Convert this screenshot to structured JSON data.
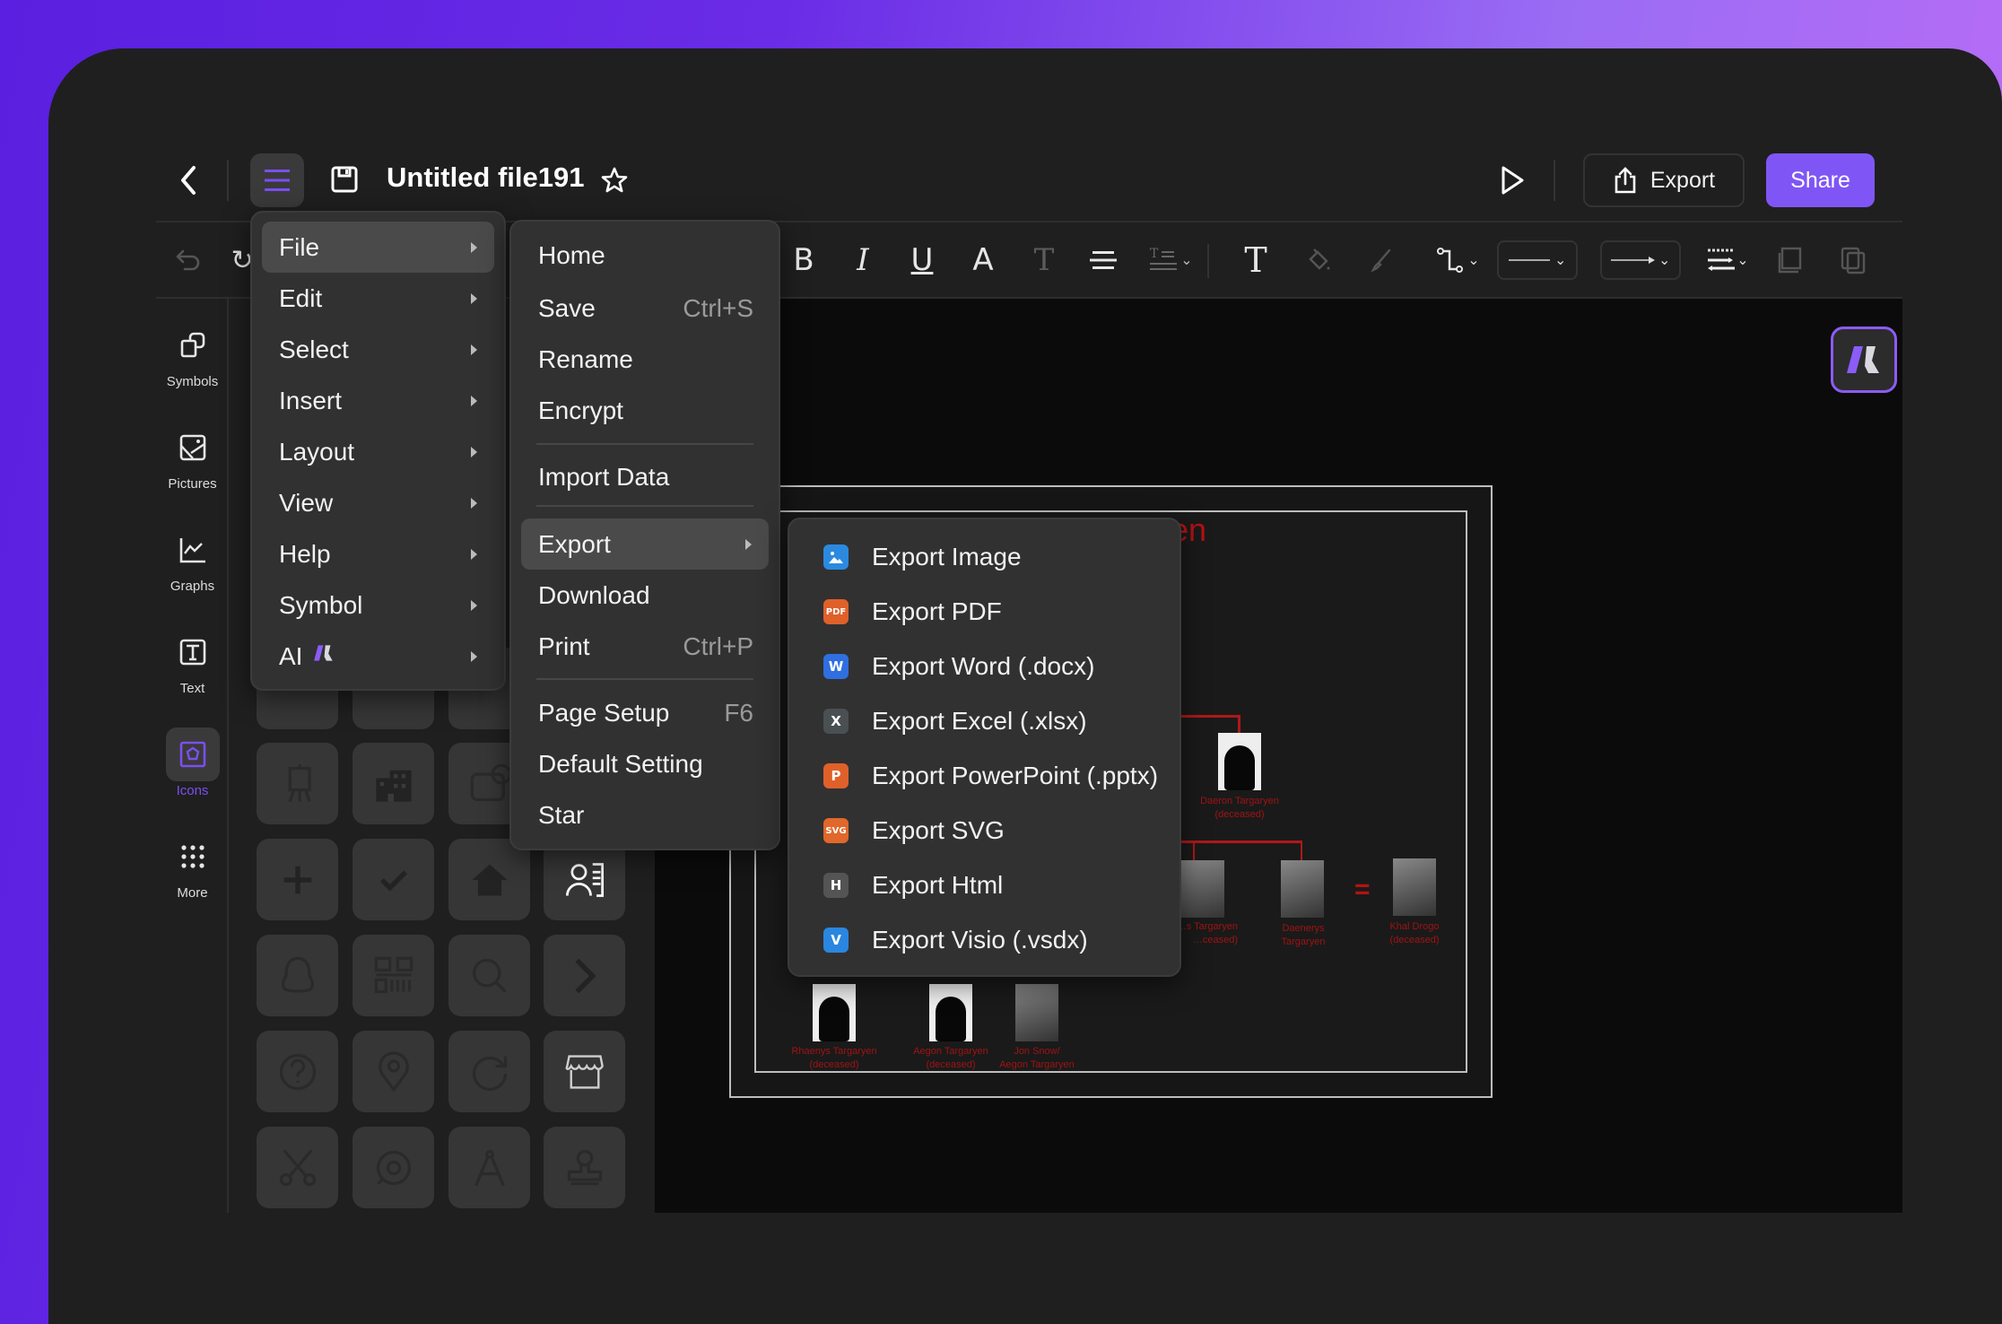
{
  "header": {
    "title": "Untitled file191",
    "export_label": "Export",
    "share_label": "Share",
    "accent_color": "#7f56f5"
  },
  "icons": {
    "back": "chevron-left-icon",
    "menu": "hamburger-icon",
    "save": "floppy-disk-icon",
    "star": "star-icon",
    "play": "play-icon",
    "export": "share-upload-icon"
  },
  "toolbar": {
    "tools": [
      "undo",
      "redo",
      "bold",
      "italic",
      "underline",
      "font-color",
      "text-style",
      "align",
      "line-spacing",
      "text",
      "fill",
      "brush",
      "connector",
      "line-style",
      "arrow-style",
      "line-jump",
      "bring-front",
      "send-back"
    ]
  },
  "sidebar": {
    "items": [
      {
        "label": "Symbols",
        "icon": "symbols-icon"
      },
      {
        "label": "Pictures",
        "icon": "pictures-icon"
      },
      {
        "label": "Graphs",
        "icon": "graphs-icon"
      },
      {
        "label": "Text",
        "icon": "text-icon"
      },
      {
        "label": "Icons",
        "icon": "icons-icon",
        "active": true
      },
      {
        "label": "More",
        "icon": "more-grid-icon"
      }
    ]
  },
  "icon_panel": {
    "tiles": [
      "easel",
      "buildings",
      "coin-card",
      "plus",
      "check",
      "home",
      "contact-card",
      "qq-penguin",
      "qr-code",
      "search",
      "chevron-right",
      "help-circle",
      "location-pin",
      "refresh",
      "store",
      "scissors",
      "target",
      "compass",
      "stamp"
    ]
  },
  "main_menu": {
    "items": [
      {
        "label": "File",
        "active": true
      },
      {
        "label": "Edit"
      },
      {
        "label": "Select"
      },
      {
        "label": "Insert"
      },
      {
        "label": "Layout"
      },
      {
        "label": "View"
      },
      {
        "label": "Help"
      },
      {
        "label": "Symbol"
      },
      {
        "label": "AI"
      }
    ]
  },
  "file_menu": {
    "items": [
      {
        "label": "Home",
        "shortcut": ""
      },
      {
        "label": "Save",
        "shortcut": "Ctrl+S"
      },
      {
        "label": "Rename",
        "shortcut": ""
      },
      {
        "label": "Encrypt",
        "shortcut": ""
      },
      {
        "label": "Import Data",
        "shortcut": ""
      },
      {
        "label": "Export",
        "shortcut": "",
        "submenu": true,
        "active": true
      },
      {
        "label": "Download",
        "shortcut": ""
      },
      {
        "label": "Print",
        "shortcut": "Ctrl+P"
      },
      {
        "label": "Page Setup",
        "shortcut": "F6"
      },
      {
        "label": "Default Setting",
        "shortcut": ""
      },
      {
        "label": "Star",
        "shortcut": ""
      }
    ]
  },
  "export_menu": {
    "items": [
      {
        "label": "Export Image",
        "badge": "",
        "color": "#2b8ae0"
      },
      {
        "label": "Export PDF",
        "badge": "PDF",
        "color": "#e0602a"
      },
      {
        "label": "Export Word (.docx)",
        "badge": "W",
        "color": "#2f6fe0"
      },
      {
        "label": "Export Excel (.xlsx)",
        "badge": "X",
        "color": "#4a5052"
      },
      {
        "label": "Export PowerPoint (.pptx)",
        "badge": "P",
        "color": "#e0602a"
      },
      {
        "label": "Export SVG",
        "badge": "SVG",
        "color": "#e0682a"
      },
      {
        "label": "Export Html",
        "badge": "H",
        "color": "#545454"
      },
      {
        "label": "Export Visio (.vsdx)",
        "badge": "V",
        "color": "#2b86e0"
      }
    ]
  },
  "canvas": {
    "title_fragment": "en",
    "people": [
      {
        "name": "Daeron Targaryen",
        "note": "(deceased)"
      },
      {
        "name": "…s Targaryen",
        "note": "…ceased)"
      },
      {
        "name": "Daenerys",
        "note": "Targaryen"
      },
      {
        "name": "Khal Drogo",
        "note": "(deceased)"
      },
      {
        "name": "Rhaenys Targaryen",
        "note": "(deceased)"
      },
      {
        "name": "Aegon Targaryen",
        "note": "(deceased)"
      },
      {
        "name": "Jon Snow/",
        "note": "Aegon Targaryen"
      }
    ],
    "marriage_symbol": "="
  }
}
